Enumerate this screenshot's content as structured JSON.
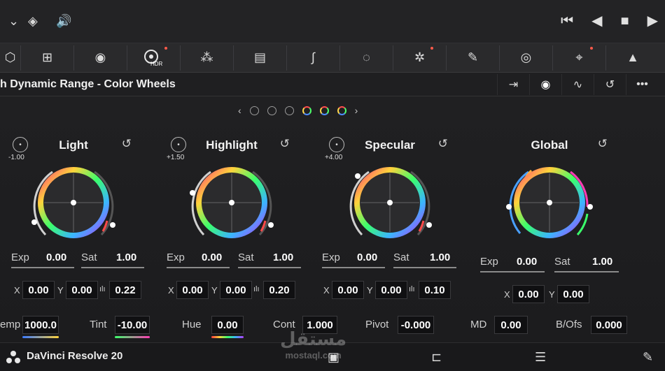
{
  "topbar": {
    "left_icons": [
      "chevron-down-icon",
      "layers-icon",
      "speaker-icon"
    ],
    "transport_icons": [
      "skip-to-start-icon",
      "play-reverse-icon",
      "stop-icon",
      "play-icon"
    ]
  },
  "tools": [
    {
      "icon": "cube-icon",
      "badge": false
    },
    {
      "icon": "grid-icon",
      "badge": false
    },
    {
      "icon": "color-wheels-icon",
      "badge": false
    },
    {
      "icon": "hdr-icon",
      "label": "HDR",
      "badge": true,
      "active": true
    },
    {
      "icon": "rgb-mixer-icon",
      "badge": false
    },
    {
      "icon": "motion-effects-icon",
      "badge": false
    },
    {
      "icon": "curves-icon",
      "badge": false
    },
    {
      "icon": "color-warper-icon",
      "badge": false
    },
    {
      "icon": "qualifier-icon",
      "badge": true
    },
    {
      "icon": "eyedropper-icon",
      "badge": false
    },
    {
      "icon": "window-icon",
      "badge": false
    },
    {
      "icon": "tracker-icon",
      "badge": true
    },
    {
      "icon": "magic-mask-icon",
      "badge": false
    }
  ],
  "panel": {
    "title": "h Dynamic Range - Color Wheels",
    "header_buttons": [
      "export-icon",
      "wheels-view-icon",
      "waveform-icon",
      "reset-all-icon",
      "more-options-icon"
    ]
  },
  "pager": {
    "prev": "‹",
    "next": "›",
    "dots": 6
  },
  "wheels": [
    {
      "name": "Light",
      "range": "-1.00",
      "exp": "0.00",
      "sat": "1.00",
      "x": "0.00",
      "y": "0.00",
      "falloff": "0.22"
    },
    {
      "name": "Highlight",
      "range": "+1.50",
      "exp": "0.00",
      "sat": "1.00",
      "x": "0.00",
      "y": "0.00",
      "falloff": "0.20"
    },
    {
      "name": "Specular",
      "range": "+4.00",
      "exp": "0.00",
      "sat": "1.00",
      "x": "0.00",
      "y": "0.00",
      "falloff": "0.10"
    },
    {
      "name": "Global",
      "range": "",
      "exp": "0.00",
      "sat": "1.00",
      "x": "0.00",
      "y": "0.00",
      "falloff": ""
    }
  ],
  "labels": {
    "exp": "Exp",
    "sat": "Sat",
    "x": "X",
    "y": "Y"
  },
  "bottom": {
    "temp_label": "emp",
    "temp": "1000.0",
    "tint_label": "Tint",
    "tint": "-10.00",
    "hue_label": "Hue",
    "hue": "0.00",
    "cont_label": "Cont",
    "cont": "1.000",
    "pivot_label": "Pivot",
    "pivot": "-0.000",
    "md_label": "MD",
    "md": "0.00",
    "bofs_label": "B/Ofs",
    "bofs": "0.000"
  },
  "footer": {
    "app_name": "DaVinci Resolve 20",
    "icons": [
      "media-page-icon",
      "edit-page-icon",
      "fairlight-page-icon",
      "deliver-page-icon"
    ]
  },
  "watermark": {
    "arabic": "مستقل",
    "latin": "mostaql.com"
  },
  "colors": {
    "accent": "#ff5a4a",
    "panel_bg": "#1f1f21"
  }
}
